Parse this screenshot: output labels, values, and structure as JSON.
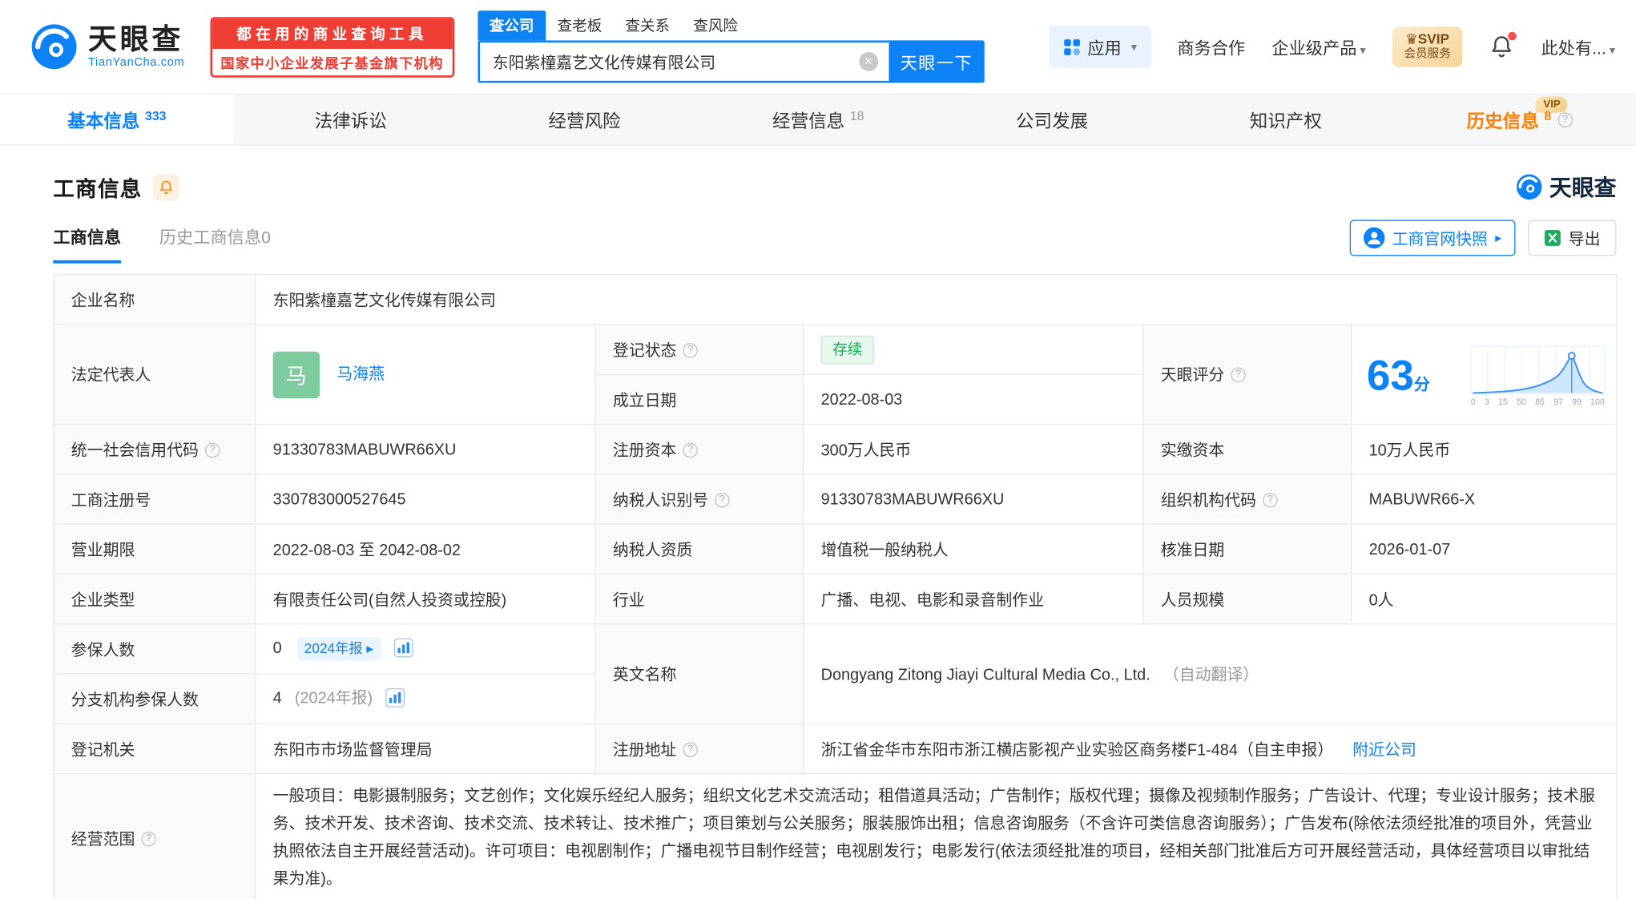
{
  "colors": {
    "primary_blue": "#0c82f5",
    "promo_red": "#ee3e33",
    "history_orange": "#ff7d00",
    "status_green": "#00b34a",
    "svip_gold": "#f6d398"
  },
  "icons": {
    "chevron_down": "▾",
    "arrow_right": "▸",
    "clear": "×",
    "help": "?",
    "crown": "♛"
  },
  "brand": {
    "name": "天眼查",
    "domain": "TianYanCha.com",
    "promo_line1": "都在用的商业查询工具",
    "promo_line2": "国家中小企业发展子基金旗下机构"
  },
  "search": {
    "tabs": [
      {
        "label": "查公司"
      },
      {
        "label": "查老板"
      },
      {
        "label": "查关系"
      },
      {
        "label": "查风险"
      }
    ],
    "value": "东阳紫橦嘉艺文化传媒有限公司",
    "button": "天眼一下"
  },
  "topnav": {
    "apps": "应用",
    "cooperation": "商务合作",
    "enterprise": "企业级产品",
    "svip_line1": "SVIP",
    "svip_line2": "会员服务",
    "user": "此处有..."
  },
  "tabs": [
    {
      "label": "基本信息",
      "count": "333"
    },
    {
      "label": "法律诉讼",
      "count": ""
    },
    {
      "label": "经营风险",
      "count": ""
    },
    {
      "label": "经营信息",
      "count": "18"
    },
    {
      "label": "公司发展",
      "count": ""
    },
    {
      "label": "知识产权",
      "count": ""
    },
    {
      "label": "历史信息",
      "count": "8",
      "vip": "VIP"
    }
  ],
  "section": {
    "title": "工商信息",
    "logo_text": "天眼查",
    "subtab_active": "工商信息",
    "subtab_history": "历史工商信息0",
    "snapshot_button": "工商官网快照",
    "export_button": "导出"
  },
  "table": {
    "company_name_label": "企业名称",
    "company_name": "东阳紫橦嘉艺文化传媒有限公司",
    "legal_rep_label": "法定代表人",
    "legal_rep_avatar": "马",
    "legal_rep_name": "马海燕",
    "reg_status_label": "登记状态",
    "reg_status": "存续",
    "tianyan_score_label": "天眼评分",
    "establish_date_label": "成立日期",
    "establish_date": "2022-08-03",
    "credit_code_label": "统一社会信用代码",
    "credit_code": "91330783MABUWR66XU",
    "reg_capital_label": "注册资本",
    "reg_capital": "300万人民币",
    "paid_capital_label": "实缴资本",
    "paid_capital": "10万人民币",
    "reg_number_label": "工商注册号",
    "reg_number": "330783000527645",
    "taxpayer_id_label": "纳税人识别号",
    "taxpayer_id": "91330783MABUWR66XU",
    "org_code_label": "组织机构代码",
    "org_code": "MABUWR66-X",
    "business_term_label": "营业期限",
    "business_term": "2022-08-03 至 2042-08-02",
    "taxpayer_quality_label": "纳税人资质",
    "taxpayer_quality": "增值税一般纳税人",
    "approval_date_label": "核准日期",
    "approval_date": "2026-01-07",
    "company_type_label": "企业类型",
    "company_type": "有限责任公司(自然人投资或控股)",
    "industry_label": "行业",
    "industry": "广播、电视、电影和录音制作业",
    "staff_size_label": "人员规模",
    "staff_size": "0人",
    "insured_label": "参保人数",
    "insured_value": "0",
    "insured_report_tag": "2024年报",
    "english_name_label": "英文名称",
    "english_name": "Dongyang Zitong Jiayi Cultural Media Co., Ltd.",
    "english_name_note": "（自动翻译）",
    "branch_insured_label": "分支机构参保人数",
    "branch_insured_value": "4",
    "branch_insured_note": "(2024年报)",
    "reg_authority_label": "登记机关",
    "reg_authority": "东阳市市场监督管理局",
    "reg_address_label": "注册地址",
    "reg_address": "浙江省金华市东阳市浙江横店影视产业实验区商务楼F1-484（自主申报）",
    "nearby_link": "附近公司",
    "business_scope_label": "经营范围",
    "business_scope": "一般项目：电影摄制服务；文艺创作；文化娱乐经纪人服务；组织文化艺术交流活动；租借道具活动；广告制作；版权代理；摄像及视频制作服务；广告设计、代理；专业设计服务；技术服务、技术开发、技术咨询、技术交流、技术转让、技术推广；项目策划与公关服务；服装服饰出租；信息咨询服务（不含许可类信息咨询服务）；广告发布(除依法须经批准的项目外，凭营业执照依法自主开展经营活动)。许可项目：电视剧制作；广播电视节目制作经营；电视剧发行；电影发行(依法须经批准的项目，经相关部门批准后方可开展经营活动，具体经营项目以审批结果为准)。"
  },
  "score_chart": {
    "type": "area",
    "value": "63",
    "unit": "分",
    "axis_ticks": [
      "0",
      "3",
      "15",
      "50",
      "85",
      "97",
      "99",
      "100"
    ]
  }
}
